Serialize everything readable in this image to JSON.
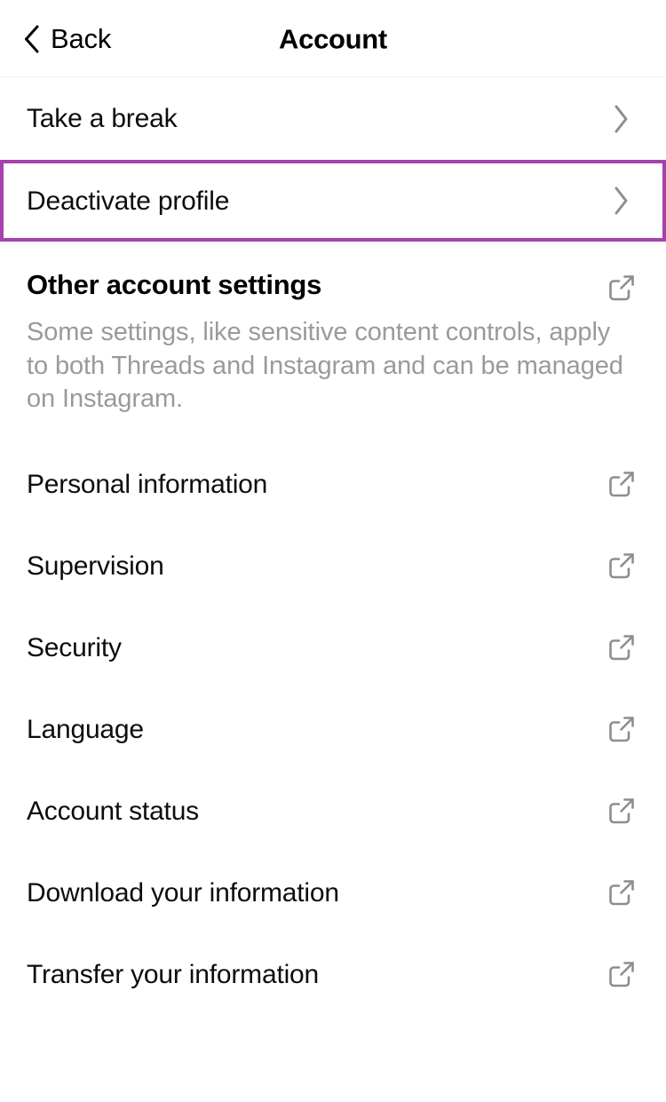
{
  "header": {
    "back_label": "Back",
    "title": "Account",
    "back_icon": "chevron-left-icon"
  },
  "nav_rows": [
    {
      "label": "Take a break",
      "icon": "chevron-right-icon",
      "highlighted": false
    },
    {
      "label": "Deactivate profile",
      "icon": "chevron-right-icon",
      "highlighted": true
    }
  ],
  "section": {
    "title": "Other account settings",
    "title_icon": "external-link-icon",
    "description": "Some settings, like sensitive content controls, apply to both Threads and Instagram and can be managed on Instagram."
  },
  "link_rows": [
    {
      "label": "Personal information",
      "icon": "external-link-icon"
    },
    {
      "label": "Supervision",
      "icon": "external-link-icon"
    },
    {
      "label": "Security",
      "icon": "external-link-icon"
    },
    {
      "label": "Language",
      "icon": "external-link-icon"
    },
    {
      "label": "Account status",
      "icon": "external-link-icon"
    },
    {
      "label": "Download your information",
      "icon": "external-link-icon"
    },
    {
      "label": "Transfer your information",
      "icon": "external-link-icon"
    }
  ],
  "colors": {
    "highlight_border": "#a641ad",
    "text_primary": "#0d0d0d",
    "text_muted": "#9a9a9a",
    "icon_gray": "#8e8e8e",
    "divider": "#f0f0f2",
    "background": "#ffffff"
  }
}
